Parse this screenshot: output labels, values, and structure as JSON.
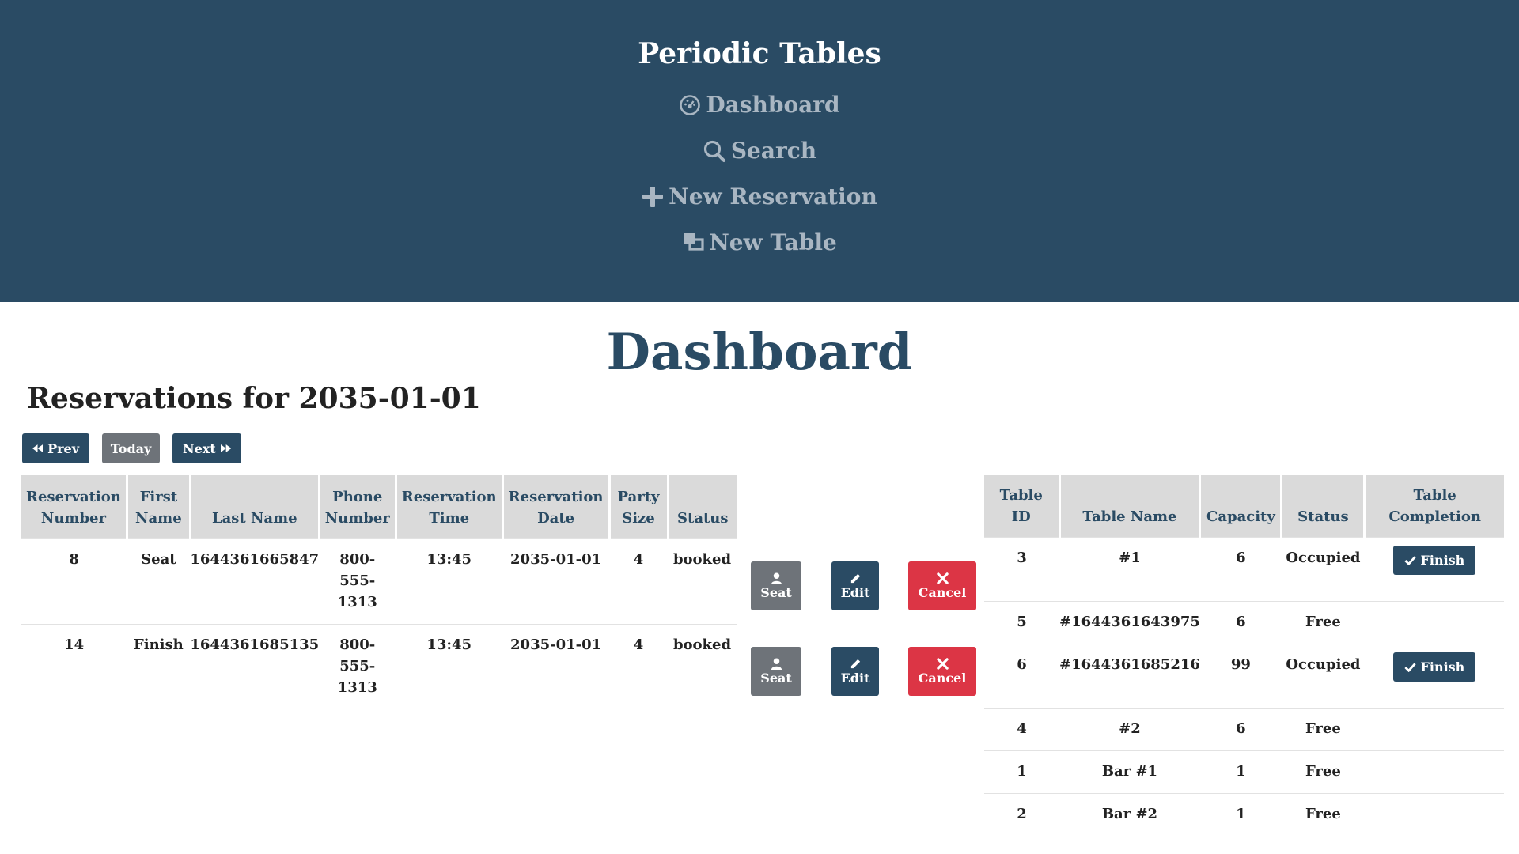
{
  "app": {
    "brand": "Periodic Tables"
  },
  "nav": [
    {
      "label": "Dashboard",
      "icon": "dashboard-icon"
    },
    {
      "label": "Search",
      "icon": "search-icon"
    },
    {
      "label": "New Reservation",
      "icon": "plus-icon"
    },
    {
      "label": "New Table",
      "icon": "new-table-icon"
    }
  ],
  "page": {
    "title": "Dashboard",
    "reservations_heading": "Reservations for 2035-01-01"
  },
  "date_nav": {
    "prev": "Prev",
    "today": "Today",
    "next": "Next"
  },
  "reservations": {
    "headers": [
      "Reservation Number",
      "First Name",
      "Last Name",
      "Phone Number",
      "Reservation Time",
      "Reservation Date",
      "Party Size",
      "Status"
    ],
    "rows": [
      {
        "number": "8",
        "first": "Seat",
        "last": "1644361665847",
        "phone": "800-555-1313",
        "time": "13:45",
        "date": "2035-01-01",
        "party": "4",
        "status": "booked"
      },
      {
        "number": "14",
        "first": "Finish",
        "last": "1644361685135",
        "phone": "800-555-1313",
        "time": "13:45",
        "date": "2035-01-01",
        "party": "4",
        "status": "booked"
      }
    ],
    "actions": {
      "seat": "Seat",
      "edit": "Edit",
      "cancel": "Cancel"
    }
  },
  "tables": {
    "headers": [
      "Table ID",
      "Table Name",
      "Capacity",
      "Status",
      "Table Completion"
    ],
    "finish_label": "Finish",
    "rows": [
      {
        "id": "3",
        "name": "#1",
        "capacity": "6",
        "status": "Occupied",
        "finish": true
      },
      {
        "id": "5",
        "name": "#1644361643975",
        "capacity": "6",
        "status": "Free",
        "finish": false
      },
      {
        "id": "6",
        "name": "#1644361685216",
        "capacity": "99",
        "status": "Occupied",
        "finish": true
      },
      {
        "id": "4",
        "name": "#2",
        "capacity": "6",
        "status": "Free",
        "finish": false
      },
      {
        "id": "1",
        "name": "Bar #1",
        "capacity": "1",
        "status": "Free",
        "finish": false
      },
      {
        "id": "2",
        "name": "Bar #2",
        "capacity": "1",
        "status": "Free",
        "finish": false
      }
    ]
  },
  "colors": {
    "navy": "#2a4b64",
    "gray": "#6e7379",
    "red": "#dc3545",
    "header_bg": "#dadada"
  }
}
